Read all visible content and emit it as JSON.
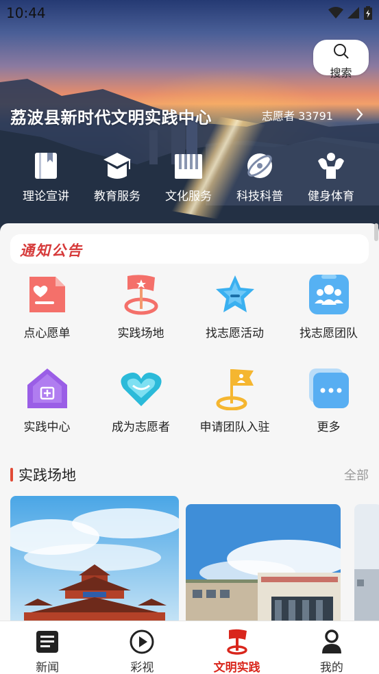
{
  "status_bar": {
    "time": "10:44"
  },
  "hero": {
    "title": "荔波县新时代文明实践中心",
    "volunteer_text": "志愿者 33791",
    "search_label": "搜索",
    "categories": [
      {
        "label": "理论宣讲",
        "icon": "book-icon"
      },
      {
        "label": "教育服务",
        "icon": "graduation-cap-icon"
      },
      {
        "label": "文化服务",
        "icon": "piano-keys-icon"
      },
      {
        "label": "科技科普",
        "icon": "science-orbit-icon"
      },
      {
        "label": "健身体育",
        "icon": "muscle-icon"
      }
    ]
  },
  "notice": {
    "label": "通知公告"
  },
  "grid": {
    "items": [
      {
        "label": "点心愿单",
        "icon": "wish-list-icon"
      },
      {
        "label": "实践场地",
        "icon": "location-flag-icon"
      },
      {
        "label": "找志愿活动",
        "icon": "star-badge-icon"
      },
      {
        "label": "找志愿团队",
        "icon": "team-icon"
      },
      {
        "label": "实践中心",
        "icon": "practice-center-icon"
      },
      {
        "label": "成为志愿者",
        "icon": "heart-icon"
      },
      {
        "label": "申请团队入驻",
        "icon": "team-flag-icon"
      },
      {
        "label": "更多",
        "icon": "more-icon"
      }
    ]
  },
  "section": {
    "title": "实践场地",
    "more": "全部"
  },
  "bottom_nav": [
    {
      "label": "新闻",
      "icon": "news-icon",
      "active": false
    },
    {
      "label": "彩视",
      "icon": "play-icon",
      "active": false
    },
    {
      "label": "文明实践",
      "icon": "flag-pin-icon",
      "active": true
    },
    {
      "label": "我的",
      "icon": "user-icon",
      "active": false
    }
  ],
  "colors": {
    "accent": "#d9261c",
    "section_bar": "#e14a36",
    "notice_text": "#d63a3a"
  }
}
